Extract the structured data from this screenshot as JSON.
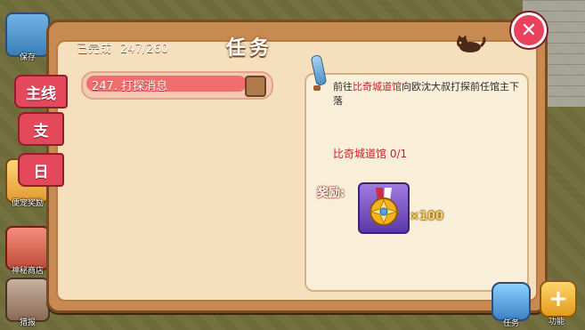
{
  "header": {
    "completed_label": "已完成",
    "completed_value": "247/260",
    "title": "任务"
  },
  "tabs": [
    {
      "label": "主线"
    },
    {
      "label": "支"
    },
    {
      "label": "日"
    }
  ],
  "left_sidebar": [
    {
      "label": "保存"
    },
    {
      "label": "便宠奖励"
    },
    {
      "label": "神秘商店"
    },
    {
      "label": "猎报"
    }
  ],
  "quest_list": [
    {
      "label": "247. 打探消息"
    }
  ],
  "details": {
    "desc_pre": "前往",
    "desc_hl": "比奇城道馆",
    "desc_post": "向欧沈大叔打探前任馆主下落",
    "progress": "比奇城道馆 0/1",
    "reward_label": "奖励:",
    "reward_qty": "×100"
  },
  "bottom_right": [
    {
      "label": "任务"
    },
    {
      "label": "功能"
    }
  ],
  "close_symbol": "✕"
}
